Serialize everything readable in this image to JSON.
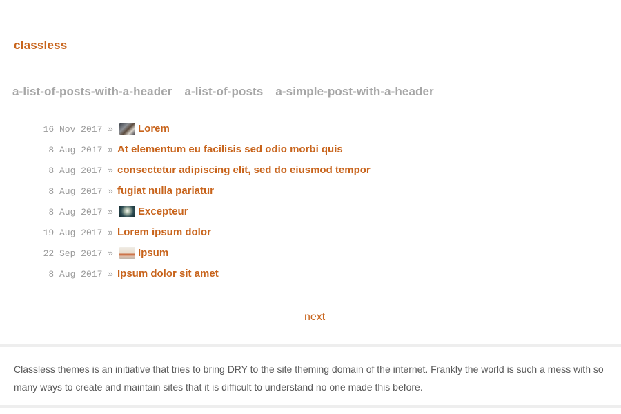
{
  "site": {
    "title": "classless"
  },
  "nav": {
    "items": [
      {
        "label": "a-list-of-posts-with-a-header"
      },
      {
        "label": "a-list-of-posts"
      },
      {
        "label": "a-simple-post-with-a-header"
      }
    ]
  },
  "posts": [
    {
      "date": "16 Nov 2017 »",
      "title": "Lorem",
      "thumbnail": "photo-thumbnail-icon"
    },
    {
      "date": "8 Aug 2017 »",
      "title": "At elementum eu facilisis sed odio morbi quis"
    },
    {
      "date": "8 Aug 2017 »",
      "title": "consectetur adipiscing elit, sed do eiusmod tempor"
    },
    {
      "date": "8 Aug 2017 »",
      "title": "fugiat nulla pariatur"
    },
    {
      "date": "8 Aug 2017 »",
      "title": "Excepteur",
      "thumbnail": "photo-thumbnail-icon"
    },
    {
      "date": "19 Aug 2017 »",
      "title": "Lorem ipsum dolor"
    },
    {
      "date": "22 Sep 2017 »",
      "title": "Ipsum",
      "thumbnail": "photo-thumbnail-icon"
    },
    {
      "date": "8 Aug 2017 »",
      "title": "Ipsum dolor sit amet"
    }
  ],
  "pagination": {
    "next_label": "next"
  },
  "footer": {
    "text": "Classless themes is an initiative that tries to bring DRY to the site theming domain of the internet. Frankly the world is such a mess with so many ways to create and maintain sites that it is difficult to understand no one made this before."
  },
  "colors": {
    "accent": "#c8641c",
    "nav": "#a6a6a6",
    "date": "#9a9a9a",
    "text": "#5a5a5a"
  }
}
